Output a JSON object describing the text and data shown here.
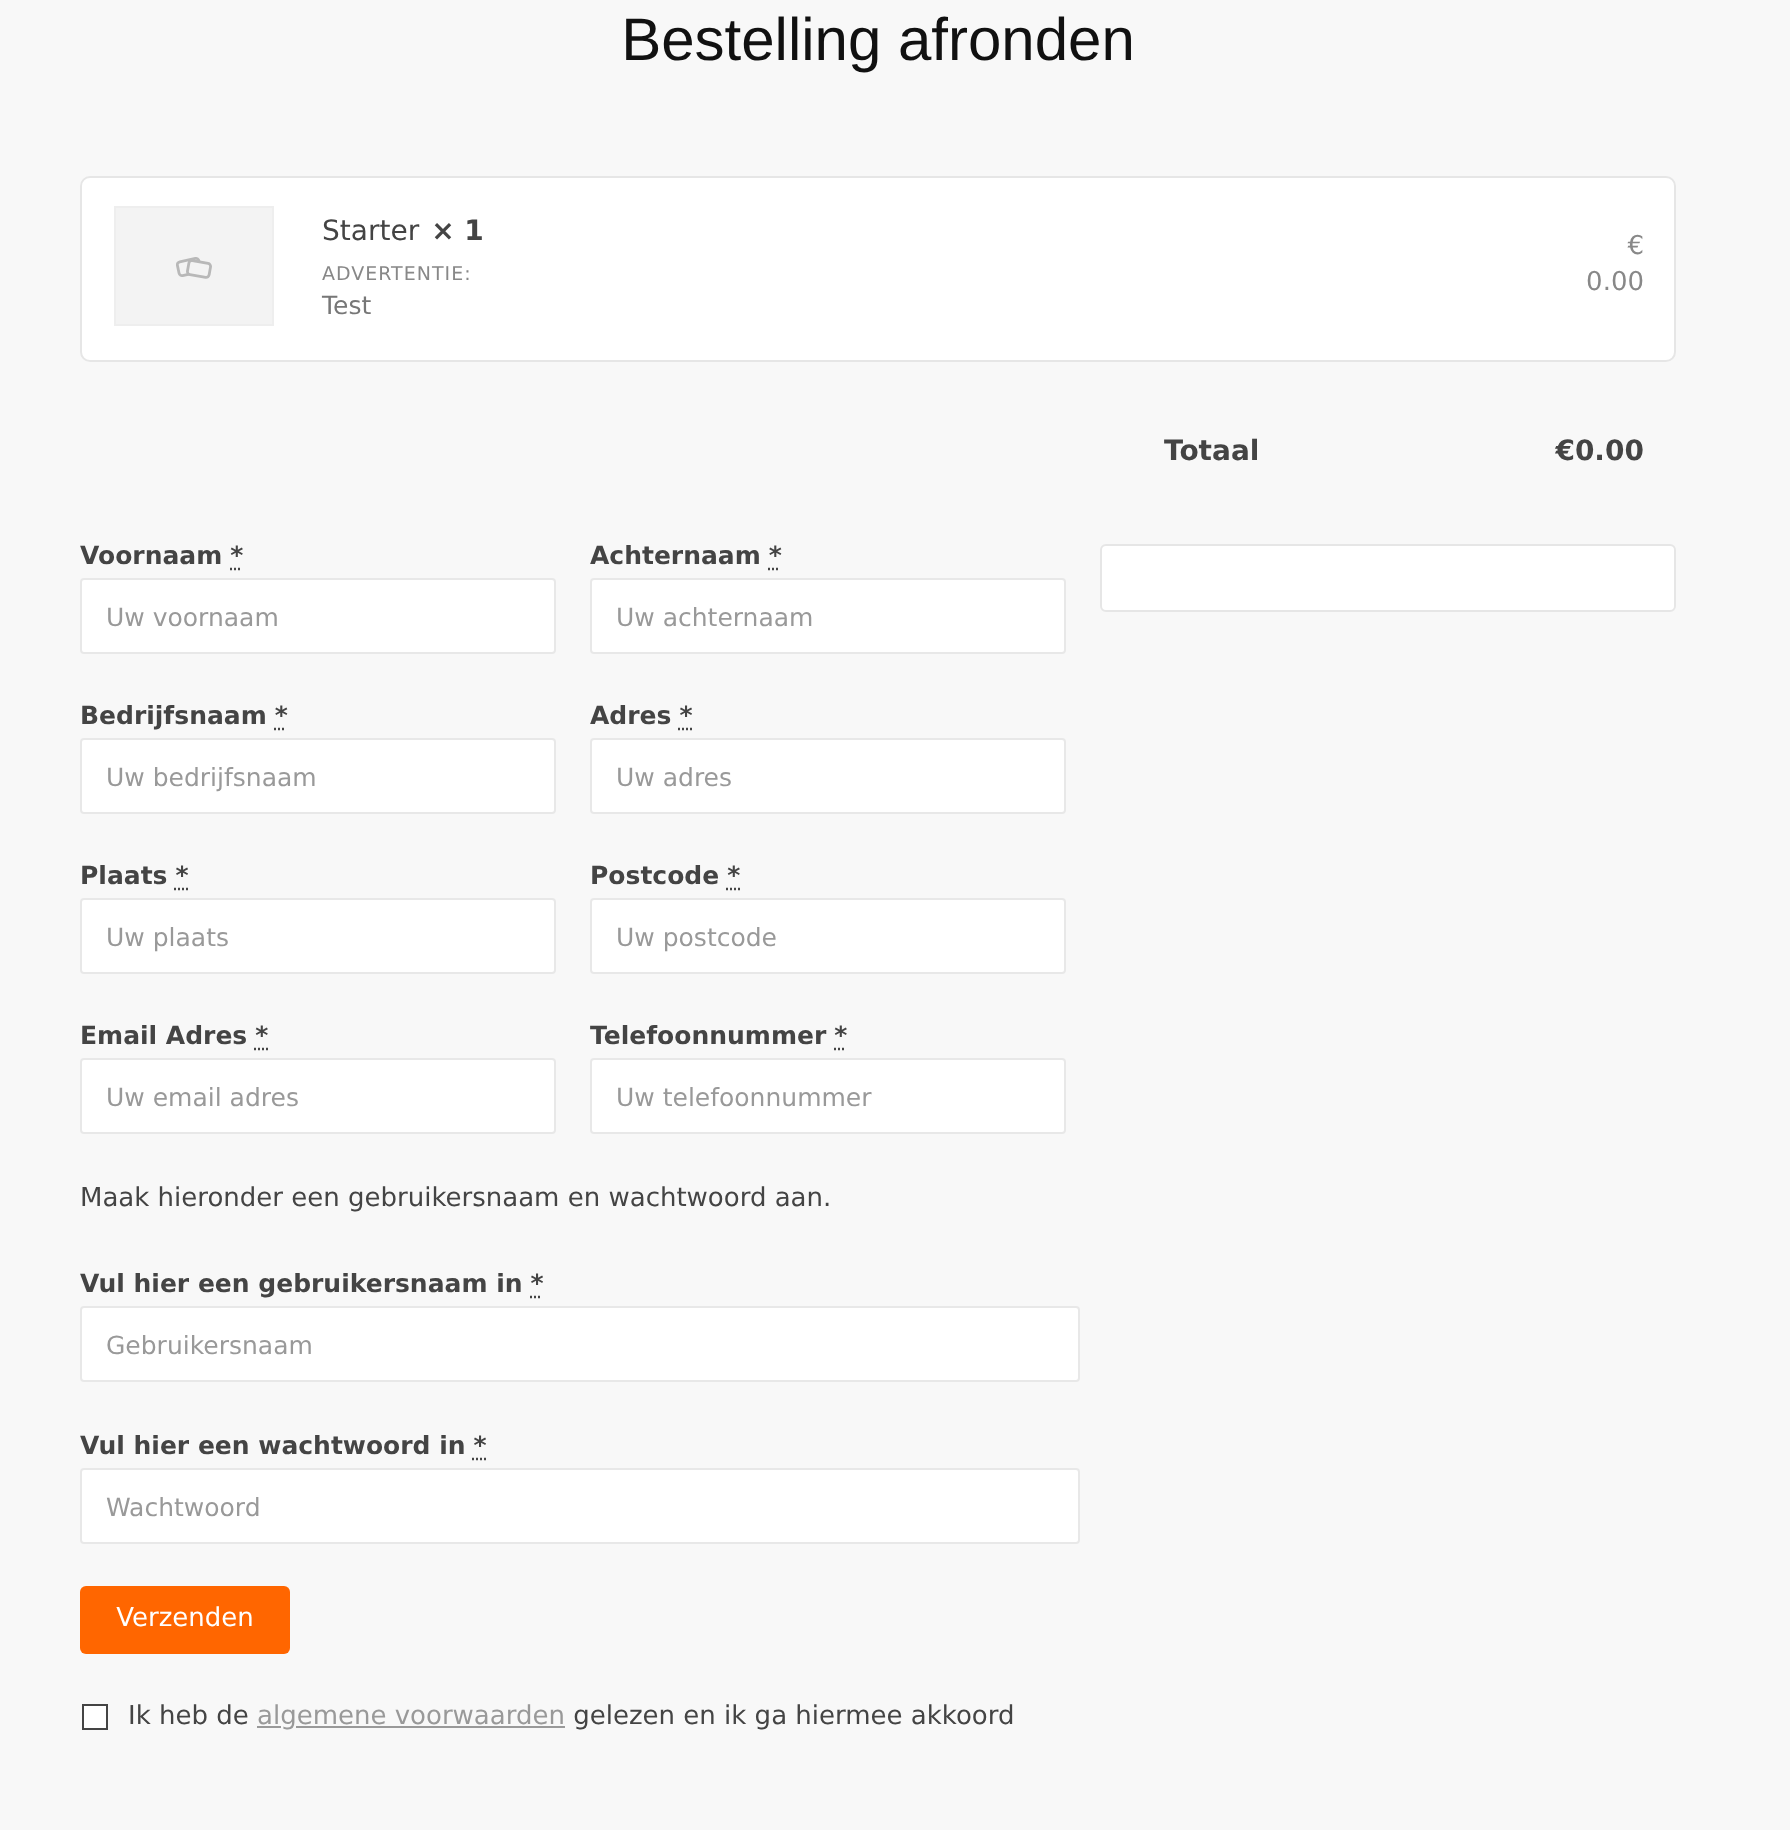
{
  "page": {
    "title": "Bestelling afronden"
  },
  "cart": {
    "items": [
      {
        "name": "Starter",
        "quantity": "× 1",
        "meta_label": "ADVERTENTIE:",
        "meta_value": "Test",
        "currency": "€",
        "price": "0.00"
      }
    ]
  },
  "totals": {
    "label": "Totaal",
    "amount": "€0.00"
  },
  "form": {
    "fields": [
      {
        "label": "Voornaam",
        "required_mark": "*",
        "placeholder": "Uw voornaam"
      },
      {
        "label": "Achternaam",
        "required_mark": "*",
        "placeholder": "Uw achternaam"
      },
      {
        "label": "Bedrijfsnaam",
        "required_mark": "*",
        "placeholder": "Uw bedrijfsnaam"
      },
      {
        "label": "Adres",
        "required_mark": "*",
        "placeholder": "Uw adres"
      },
      {
        "label": "Plaats",
        "required_mark": "*",
        "placeholder": "Uw plaats"
      },
      {
        "label": "Postcode",
        "required_mark": "*",
        "placeholder": "Uw postcode"
      },
      {
        "label": "Email Adres",
        "required_mark": "*",
        "placeholder": "Uw email adres"
      },
      {
        "label": "Telefoonnummer",
        "required_mark": "*",
        "placeholder": "Uw telefoonnummer"
      }
    ],
    "note": "Maak hieronder een gebruikersnaam en wachtwoord aan.",
    "account_fields": [
      {
        "label": "Vul hier een gebruikersnaam in",
        "required_mark": "*",
        "placeholder": "Gebruikersnaam"
      },
      {
        "label": "Vul hier een wachtwoord in",
        "required_mark": "*",
        "placeholder": "Wachtwoord"
      }
    ],
    "submit": "Verzenden",
    "terms": {
      "checked": false,
      "text_before": "Ik heb de",
      "link": "algemene voorwaarden",
      "text_after": "gelezen en ik ga hiermee akkoord"
    }
  }
}
